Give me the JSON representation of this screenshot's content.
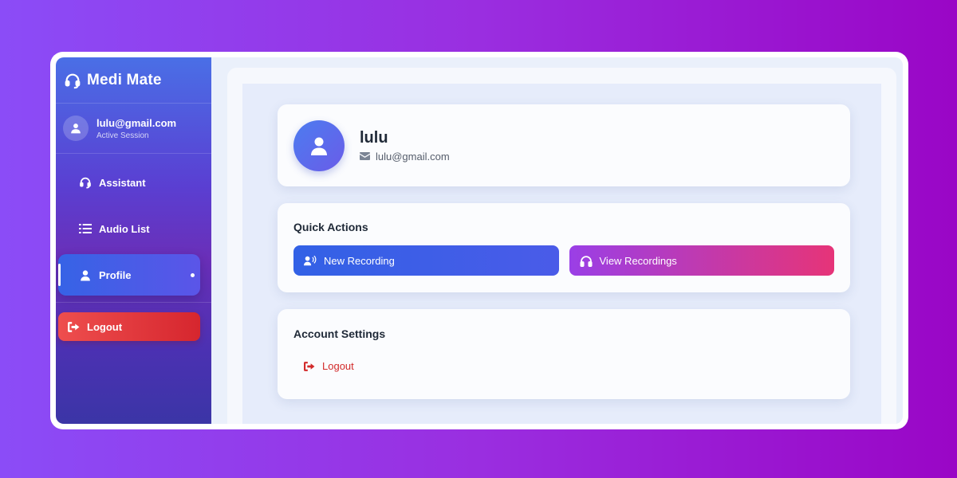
{
  "app": {
    "title": "Medi Mate"
  },
  "user": {
    "email": "lulu@gmail.com",
    "status": "Active Session"
  },
  "nav": {
    "items": [
      {
        "label": "Assistant",
        "icon": "headset-icon"
      },
      {
        "label": "Audio List",
        "icon": "list-icon"
      },
      {
        "label": "Profile",
        "icon": "user-icon",
        "active": true
      }
    ],
    "logout_label": "Logout"
  },
  "profile": {
    "name": "lulu",
    "email": "lulu@gmail.com"
  },
  "quick_actions": {
    "title": "Quick Actions",
    "new_recording": "New Recording",
    "view_recordings": "View Recordings"
  },
  "account_settings": {
    "title": "Account Settings",
    "logout": "Logout"
  },
  "colors": {
    "logout_red": "#d22a2a",
    "primary_blue": "#3261e6",
    "accent_pink": "#e63478"
  }
}
